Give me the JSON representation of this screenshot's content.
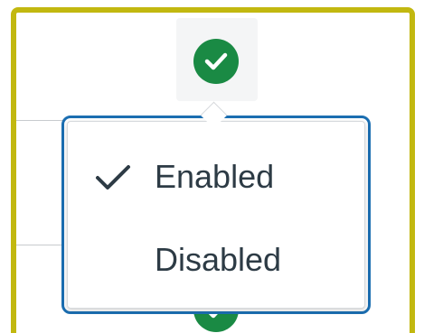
{
  "status_menu": {
    "current_status": "Enabled",
    "items": [
      {
        "label": "Enabled",
        "selected": true,
        "icon": "checkmark-icon"
      },
      {
        "label": "Disabled",
        "selected": false
      }
    ]
  },
  "status_indicator": {
    "icon": "check-circle-icon",
    "state": "enabled"
  },
  "colors": {
    "focus_ring": "#c2b810",
    "popover_border": "#1b6eb1",
    "status_green": "#1a8a44",
    "menu_text": "#2d3b45"
  }
}
